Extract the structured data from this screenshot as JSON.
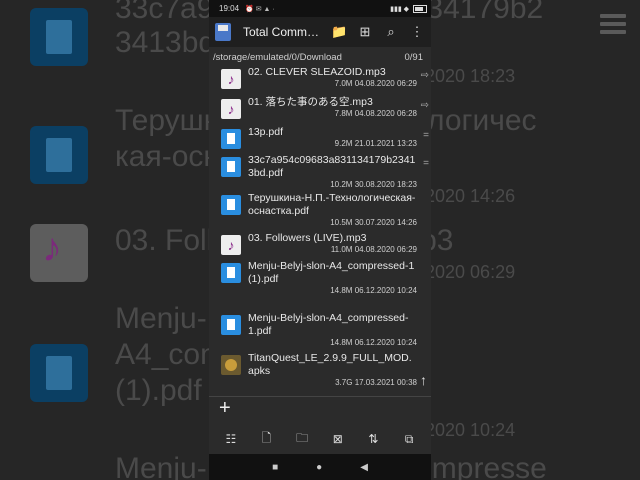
{
  "background_text": [
    "33c7a954c09683a831134179b2",
    "3413bd.pdf",
    "2020   18:23",
    "Терушкина-Н.П.-Технологичес",
    "кая-оснастка.pdf",
    "2020   14:26",
    "03. Followers (LIVE).mp3",
    "2020   06:29",
    "Menju-Belyj-slon-",
    "A4_compressed-1",
    "(1).pdf",
    "2020   10:24",
    "Menju-Belyj-slon-A4_compresse"
  ],
  "statusbar": {
    "time": "19:04",
    "icons": "⏰ ✉ ▲ ·",
    "right": "▮▮▮ ◆"
  },
  "toolbar": {
    "title": "Total Comm…",
    "folder_icon": "📁",
    "add_icon": "⊞",
    "search_icon": "⌕",
    "menu_icon": "⋮"
  },
  "path": {
    "text": "/storage/emulated/0/Download",
    "count": "0/91"
  },
  "files": [
    {
      "type": "mp3",
      "name": "02. CLEVER SLEAZOID.mp3",
      "size": "7.0M",
      "date": "04.08.2020",
      "time": "06:29",
      "mark": "⇨"
    },
    {
      "type": "mp3",
      "name": "01. 落ちた事のある空.mp3",
      "size": "7.8M",
      "date": "04.08.2020",
      "time": "06:28",
      "mark": "⇨"
    },
    {
      "type": "pdf",
      "name": "13p.pdf",
      "size": "9.2M",
      "date": "21.01.2021",
      "time": "13:23",
      "mark": "="
    },
    {
      "type": "pdf",
      "name": "33c7a954c09683a831134179b23413bd.pdf",
      "size": "10.2M",
      "date": "30.08.2020",
      "time": "18:23",
      "mark": "="
    },
    {
      "type": "pdf",
      "name": "Терушкина-Н.П.-Технологическая-оснастка.pdf",
      "size": "10.5M",
      "date": "30.07.2020",
      "time": "14:26",
      "mark": ""
    },
    {
      "type": "mp3",
      "name": "03. Followers (LIVE).mp3",
      "size": "11.0M",
      "date": "04.08.2020",
      "time": "06:29",
      "mark": ""
    },
    {
      "type": "pdf",
      "name": "Menju-Belyj-slon-A4_compressed-1 (1).pdf",
      "size": "14.8M",
      "date": "06.12.2020",
      "time": "10:24",
      "mark": ""
    },
    {
      "type": "pdf",
      "name": "Menju-Belyj-slon-A4_compressed-1.pdf",
      "size": "14.8M",
      "date": "06.12.2020",
      "time": "10:24",
      "mark": ""
    },
    {
      "type": "apk",
      "name": "TitanQuest_LE_2.9.9_FULL_MOD.apks",
      "size": "3.7G",
      "date": "17.03.2021",
      "time": "00:38",
      "mark": ""
    }
  ],
  "bottom": {
    "plus": "+",
    "actions": [
      "☷",
      "🗋",
      "🗀",
      "⊠",
      "⇅",
      "⧉"
    ],
    "scroll_up": "↑",
    "nav": [
      "■",
      "●",
      "◀"
    ]
  },
  "colors": {
    "accent_pdf": "#2a8ee0",
    "mp3_icon": "#8a2a8a",
    "background": "#2b2b2b"
  }
}
